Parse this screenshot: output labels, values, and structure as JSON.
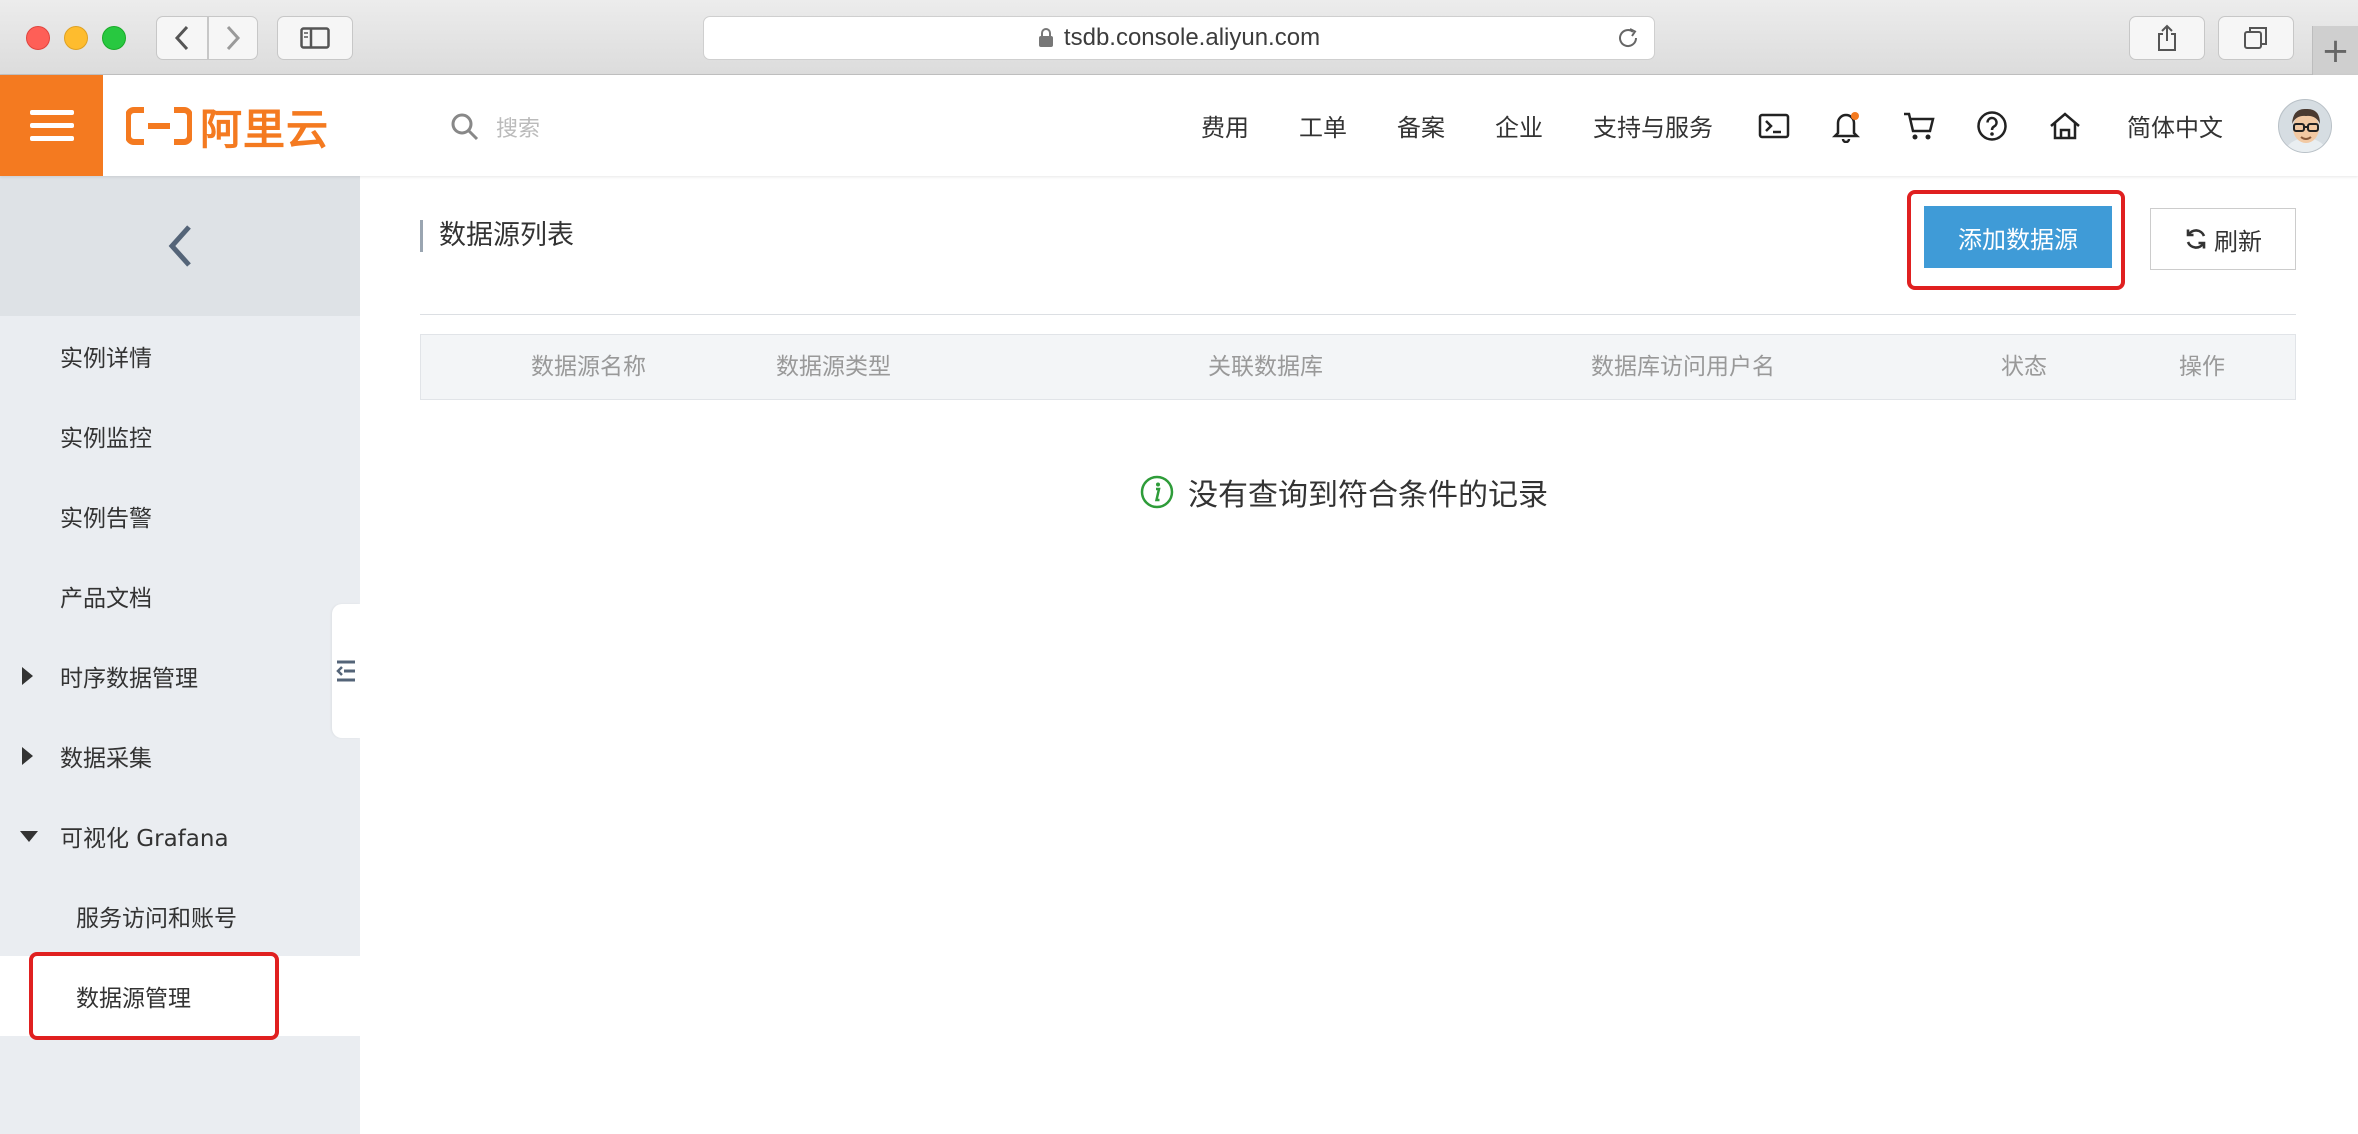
{
  "browser": {
    "url": "tsdb.console.aliyun.com",
    "new_tab": "+"
  },
  "topbar": {
    "logo_text": "阿里云",
    "search_placeholder": "搜索",
    "nav": [
      "费用",
      "工单",
      "备案",
      "企业",
      "支持与服务"
    ],
    "icons": [
      "terminal-icon",
      "bell-icon",
      "cart-icon",
      "help-icon",
      "home-icon"
    ],
    "language": "简体中文",
    "brand_color": "#f47a20"
  },
  "sidebar": {
    "items": [
      {
        "label": "实例详情"
      },
      {
        "label": "实例监控"
      },
      {
        "label": "实例告警"
      },
      {
        "label": "产品文档"
      },
      {
        "label": "时序数据管理"
      },
      {
        "label": "数据采集"
      },
      {
        "label": "可视化 Grafana"
      },
      {
        "label": "服务访问和账号"
      },
      {
        "label": "数据源管理"
      }
    ]
  },
  "main": {
    "title": "数据源列表",
    "add_button": "添加数据源",
    "refresh_button": "刷新",
    "columns": [
      "数据源名称",
      "数据源类型",
      "关联数据库",
      "数据库访问用户名",
      "状态",
      "操作"
    ],
    "empty_message": "没有查询到符合条件的记录",
    "accent_color": "#3f9bd7"
  }
}
